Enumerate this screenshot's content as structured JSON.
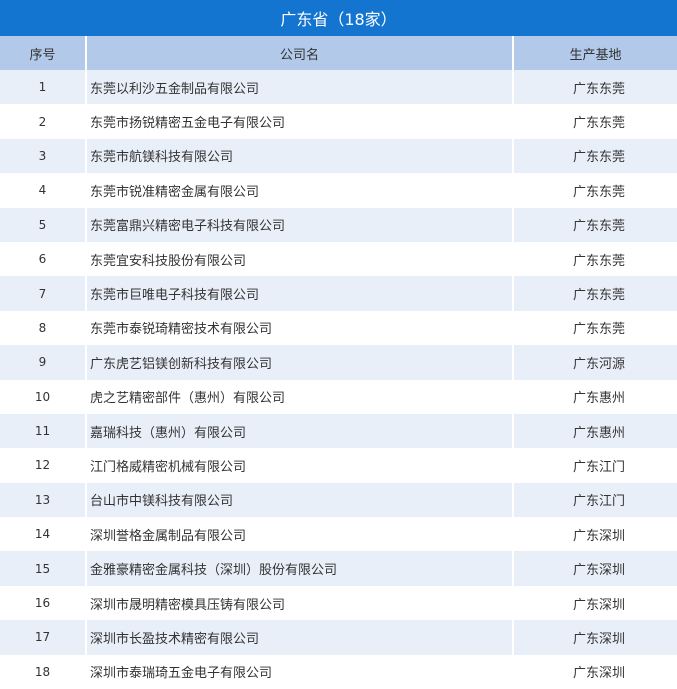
{
  "title": "广东省（18家）",
  "headers": {
    "index": "序号",
    "company": "公司名",
    "base": "生产基地"
  },
  "rows": [
    {
      "index": "1",
      "company": "东莞以利沙五金制品有限公司",
      "base": "广东东莞"
    },
    {
      "index": "2",
      "company": "东莞市扬锐精密五金电子有限公司",
      "base": "广东东莞"
    },
    {
      "index": "3",
      "company": "东莞市航镁科技有限公司",
      "base": "广东东莞"
    },
    {
      "index": "4",
      "company": "东莞市锐准精密金属有限公司",
      "base": "广东东莞"
    },
    {
      "index": "5",
      "company": "东莞富鼎兴精密电子科技有限公司",
      "base": "广东东莞"
    },
    {
      "index": "6",
      "company": "东莞宜安科技股份有限公司",
      "base": "广东东莞"
    },
    {
      "index": "7",
      "company": "东莞市巨唯电子科技有限公司",
      "base": "广东东莞"
    },
    {
      "index": "8",
      "company": "东莞市泰锐琦精密技术有限公司",
      "base": "广东东莞"
    },
    {
      "index": "9",
      "company": "广东虎艺铝镁创新科技有限公司",
      "base": "广东河源"
    },
    {
      "index": "10",
      "company": "虎之艺精密部件（惠州）有限公司",
      "base": "广东惠州"
    },
    {
      "index": "11",
      "company": "嘉瑞科技（惠州）有限公司",
      "base": "广东惠州"
    },
    {
      "index": "12",
      "company": "江门格威精密机械有限公司",
      "base": "广东江门"
    },
    {
      "index": "13",
      "company": "台山市中镁科技有限公司",
      "base": "广东江门"
    },
    {
      "index": "14",
      "company": "深圳誉格金属制品有限公司",
      "base": "广东深圳"
    },
    {
      "index": "15",
      "company": "金雅豪精密金属科技（深圳）股份有限公司",
      "base": "广东深圳"
    },
    {
      "index": "16",
      "company": "深圳市晟明精密模具压铸有限公司",
      "base": "广东深圳"
    },
    {
      "index": "17",
      "company": "深圳市长盈技术精密有限公司",
      "base": "广东深圳"
    },
    {
      "index": "18",
      "company": "深圳市泰瑞琦五金电子有限公司",
      "base": "广东深圳"
    }
  ]
}
